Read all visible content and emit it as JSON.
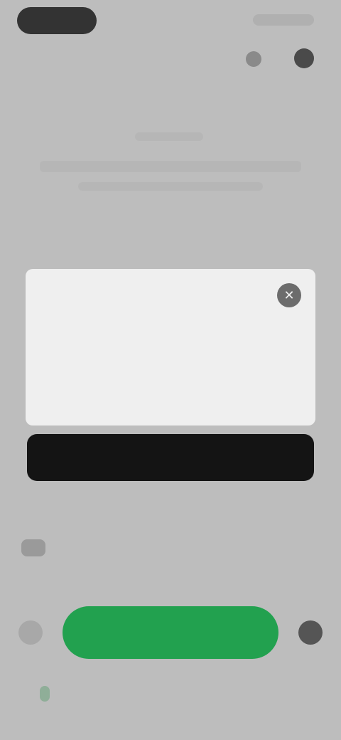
{
  "header": {
    "status_indicator": "status-pill",
    "icons": [
      "refresh-icon",
      "avatar-icon"
    ]
  },
  "dialog": {
    "title": "",
    "body": "",
    "close_icon": "close-icon"
  },
  "actions": {
    "primary_label": "",
    "row_label": "",
    "green_label": ""
  },
  "colors": {
    "background": "#bdbdbd",
    "card": "#efefef",
    "primary_button": "#141414",
    "green_button": "#22a14f"
  }
}
